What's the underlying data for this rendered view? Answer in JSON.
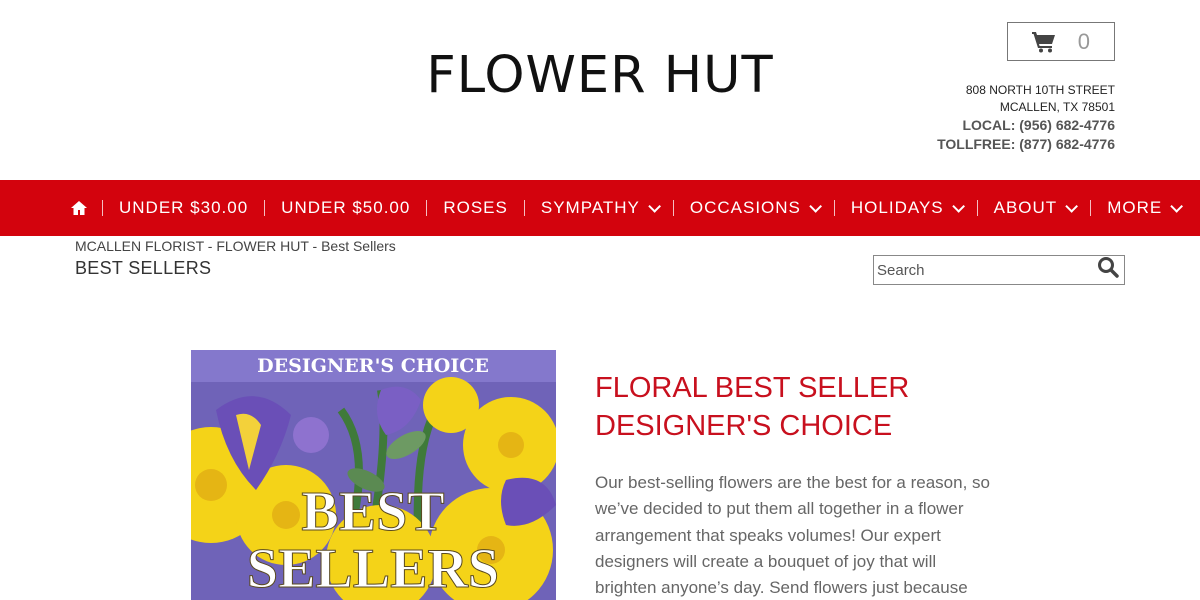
{
  "header": {
    "logo_text": "FLOWER HUT",
    "cart_count": "0",
    "address_line1": "808 NORTH 10TH STREET",
    "address_line2": "MCALLEN, TX 78501",
    "local_phone": "LOCAL: (956) 682-4776",
    "tollfree_phone": "TOLLFREE: (877) 682-4776"
  },
  "nav": {
    "background": "#d3030d",
    "items": [
      {
        "label": "UNDER $30.00"
      },
      {
        "label": "UNDER $50.00"
      },
      {
        "label": "ROSES"
      },
      {
        "label": "SYMPATHY"
      },
      {
        "label": "OCCASIONS"
      },
      {
        "label": "HOLIDAYS"
      },
      {
        "label": "ABOUT"
      },
      {
        "label": "MORE"
      }
    ]
  },
  "breadcrumb": "MCALLEN FLORIST - FLOWER HUT - Best Sellers",
  "page_title": "BEST SELLERS",
  "search": {
    "placeholder": "Search"
  },
  "product": {
    "image_banner": "DESIGNER'S CHOICE",
    "image_text_line1": "BEST",
    "image_text_line2": "SELLERS",
    "title_line1": "FLORAL BEST SELLER",
    "title_line2": "DESIGNER'S CHOICE",
    "title_color": "#c8101e",
    "description": "Our best-selling flowers are the best for a reason, so we’ve decided to put them all together in a flower arrangement that speaks volumes! Our expert designers will create a bouquet of joy that will brighten anyone’s day. Send flowers just because"
  }
}
